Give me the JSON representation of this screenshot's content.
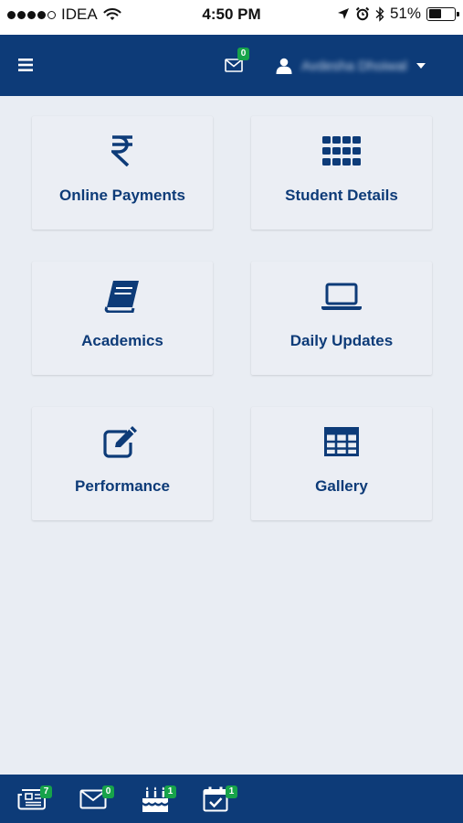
{
  "status_bar": {
    "carrier": "IDEA",
    "time": "4:50 PM",
    "battery": "51%",
    "battery_level": 0.51,
    "signal_bars_filled": 4,
    "signal_bars_total": 5
  },
  "header": {
    "menu_icon": "hamburger-menu-icon",
    "messages_badge": "0",
    "user_name": "Avdesha Dhoiwal",
    "colors": {
      "brand": "#0d3b78",
      "badge": "#17a34a"
    }
  },
  "tiles": [
    {
      "label": "Online Payments",
      "icon": "rupee-icon"
    },
    {
      "label": "Student Details",
      "icon": "grid-icon"
    },
    {
      "label": "Academics",
      "icon": "book-icon"
    },
    {
      "label": "Daily Updates",
      "icon": "laptop-icon"
    },
    {
      "label": "Performance",
      "icon": "edit-icon"
    },
    {
      "label": "Gallery",
      "icon": "table-icon"
    }
  ],
  "bottom_nav": [
    {
      "icon": "newspaper-icon",
      "badge": "7"
    },
    {
      "icon": "envelope-icon",
      "badge": "0"
    },
    {
      "icon": "birthday-cake-icon",
      "badge": "1"
    },
    {
      "icon": "calendar-check-icon",
      "badge": "1"
    }
  ]
}
